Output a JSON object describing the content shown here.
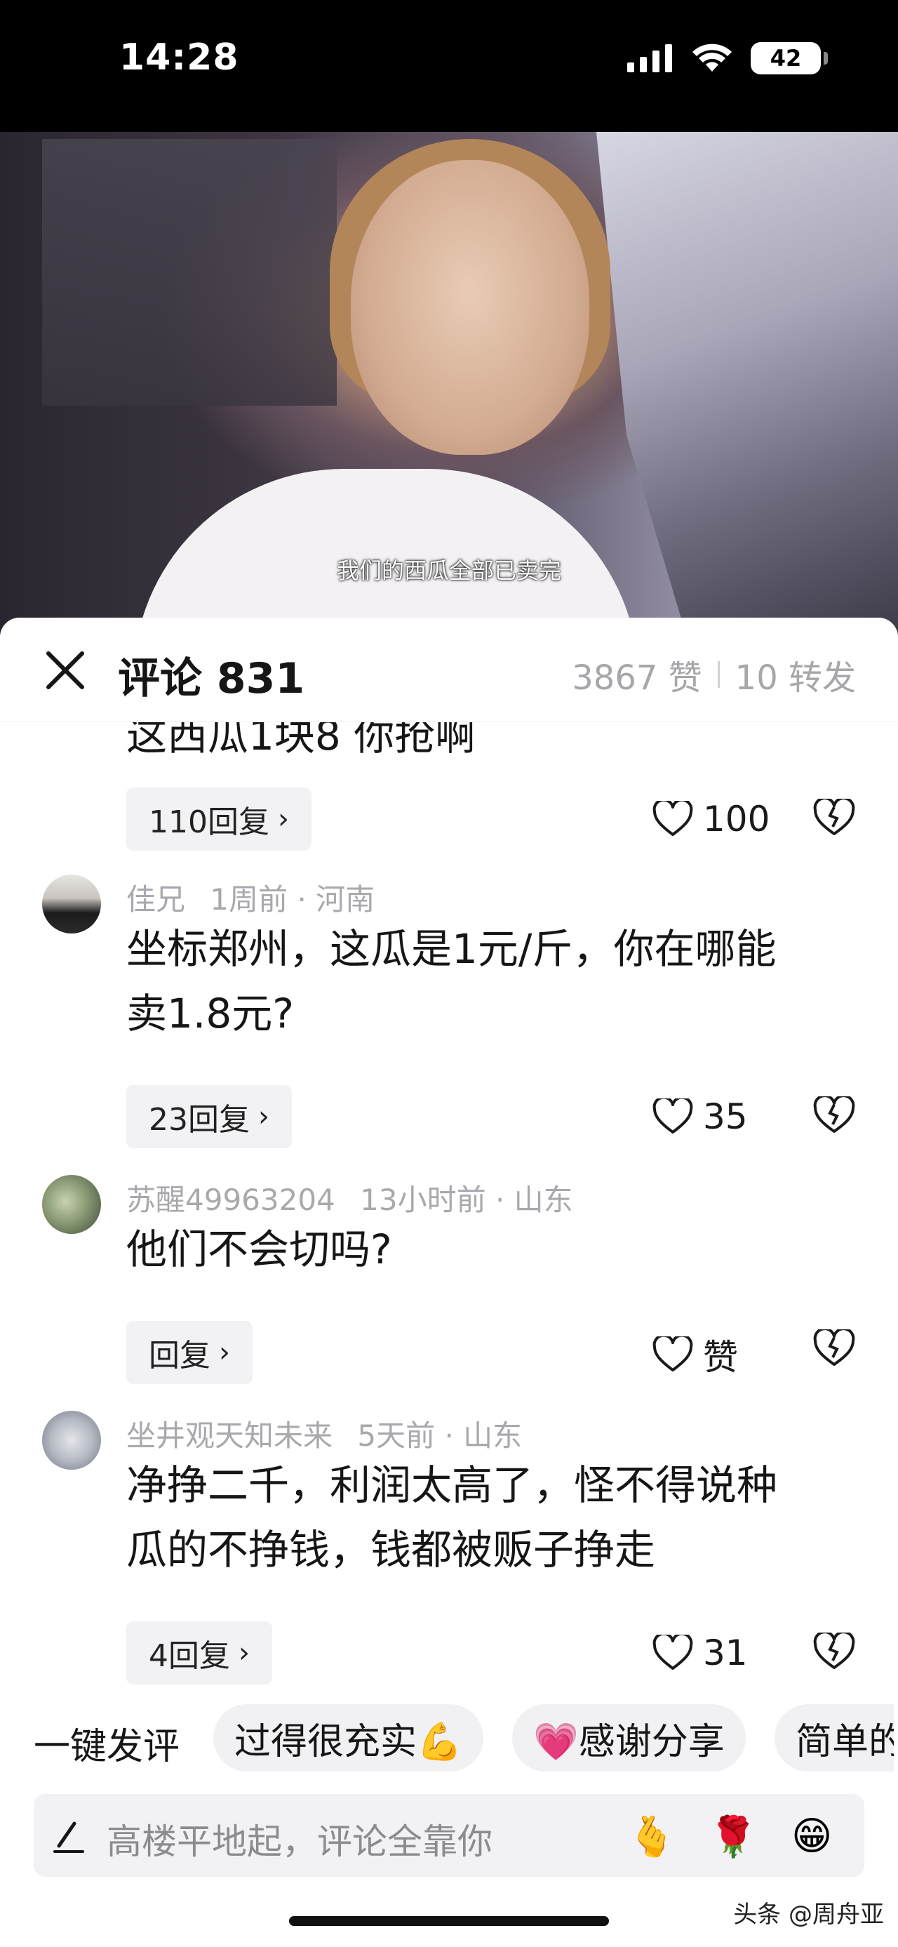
{
  "status": {
    "time": "14:28",
    "battery": "42"
  },
  "video": {
    "subtitle": "我们的西瓜全部已卖完"
  },
  "sheet": {
    "title": "评论 831",
    "likes": "3867 赞",
    "shares": "10 转发"
  },
  "comments": [
    {
      "text": "这西瓜1块8 你抢啊",
      "replies": "110回复",
      "likes": "100"
    },
    {
      "author": "佳兄",
      "time": "1周前",
      "location": "河南",
      "text_line1": "坐标郑州，这瓜是1元/斤，你在哪能",
      "text_line2": "卖1.8元?",
      "replies": "23回复",
      "likes": "35"
    },
    {
      "author": "苏醒49963204",
      "time": "13小时前",
      "location": "山东",
      "text": "他们不会切吗?",
      "replies": "回复",
      "likes": "赞"
    },
    {
      "author": "坐井观天知未来",
      "time": "5天前",
      "location": "山东",
      "text_line1": "净挣二千，利润太高了，怪不得说种",
      "text_line2": "瓜的不挣钱，钱都被贩子挣走",
      "replies": "4回复",
      "likes": "31"
    }
  ],
  "quick_comments": {
    "label": "一键发评",
    "chips": [
      "过得很充实💪",
      "💗感谢分享",
      "简单的"
    ]
  },
  "input": {
    "placeholder": "高楼平地起，评论全靠你",
    "emojis": [
      "🫰",
      "🌹",
      "😁"
    ]
  },
  "watermark": "头条 @周舟亚"
}
